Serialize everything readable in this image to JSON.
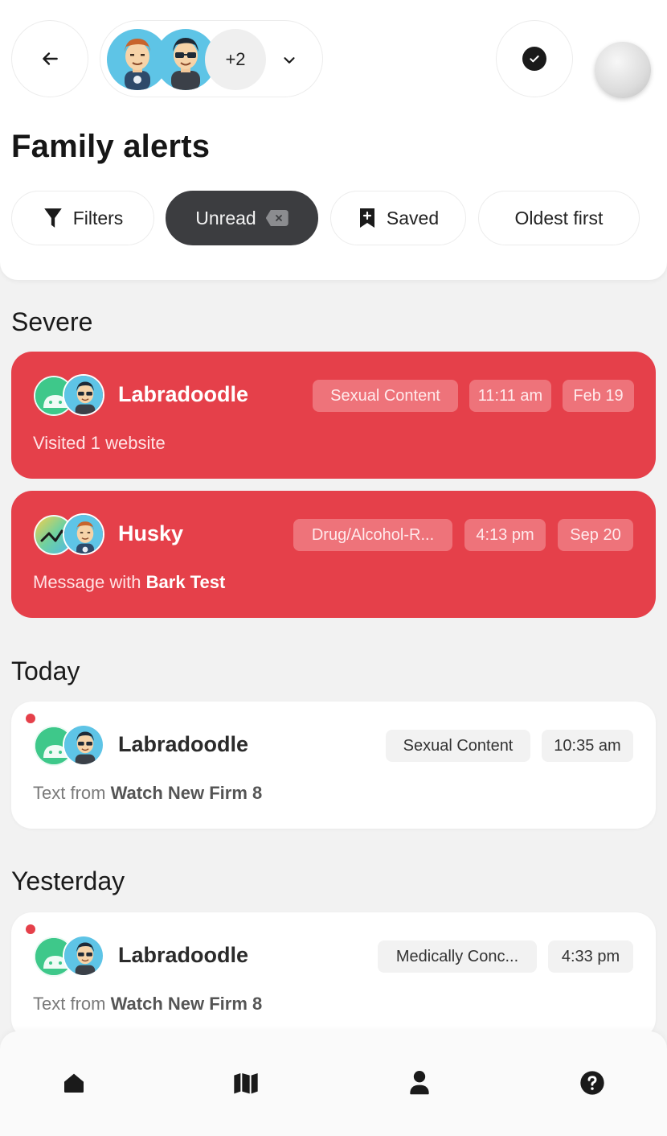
{
  "header": {
    "back_icon": "arrow-left-icon",
    "check_icon": "check-circle-icon",
    "profiles": {
      "more_count": "+2",
      "chevron_icon": "chevron-down-icon"
    },
    "title": "Family alerts"
  },
  "chips": {
    "filters": {
      "label": "Filters",
      "icon": "filter-icon"
    },
    "unread": {
      "label": "Unread",
      "icon": "clear-icon"
    },
    "saved": {
      "label": "Saved",
      "icon": "bookmark-plus-icon"
    },
    "oldest": {
      "label": "Oldest first"
    }
  },
  "sections": {
    "severe": "Severe",
    "today": "Today",
    "yesterday": "Yesterday"
  },
  "alerts": [
    {
      "name": "Labradoodle",
      "subtitle": "Visited 1 website",
      "category": "Sexual Content",
      "time": "11:11 am",
      "date": "Feb 19",
      "os_icon": "android-icon",
      "severity": "severe"
    },
    {
      "name": "Husky",
      "subtitle_prefix": "Message with",
      "subtitle_bold": "Bark Test",
      "category": "Drug/Alcohol-R...",
      "time": "4:13 pm",
      "date": "Sep 20",
      "os_icon": "activity-icon",
      "severity": "severe"
    },
    {
      "name": "Labradoodle",
      "subtitle_prefix": "Text from",
      "subtitle_bold": "Watch New Firm 8",
      "category": "Sexual Content",
      "time": "10:35 am",
      "os_icon": "android-icon",
      "unread": true
    },
    {
      "name": "Labradoodle",
      "subtitle_prefix": "Text from",
      "subtitle_bold": "Watch New Firm 8",
      "category": "Medically Conc...",
      "time": "4:33 pm",
      "os_icon": "android-icon",
      "unread": true
    }
  ],
  "nav": {
    "home_icon": "home-icon",
    "map_icon": "map-icon",
    "profile_icon": "person-icon",
    "help_icon": "help-icon"
  },
  "colors": {
    "severe": "#e5404a",
    "severe_tag": "#ee737a",
    "unread_chip": "#3c3d40",
    "android_green": "#3ec88a"
  }
}
